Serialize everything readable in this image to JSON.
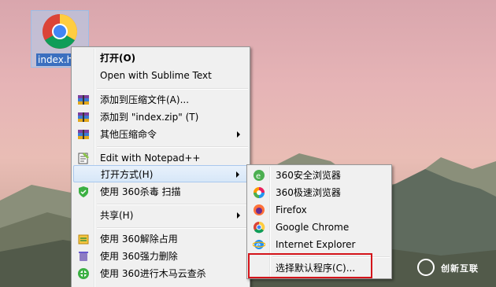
{
  "desktop": {
    "icon_label": "index.h"
  },
  "context_menu": {
    "items": [
      {
        "label": "打开(O)",
        "icon": "none"
      },
      {
        "label": "Open with Sublime Text",
        "icon": "none"
      },
      {
        "label": "添加到压缩文件(A)...",
        "icon": "archive-icon"
      },
      {
        "label": "添加到 \"index.zip\" (T)",
        "icon": "archive-icon"
      },
      {
        "label": "其他压缩命令",
        "icon": "archive-icon"
      },
      {
        "label": "Edit with Notepad++",
        "icon": "notepad-icon"
      },
      {
        "label": "打开方式(H)",
        "icon": "none"
      },
      {
        "label": "使用 360杀毒 扫描",
        "icon": "shield-icon"
      },
      {
        "label": "共享(H)",
        "icon": "none"
      },
      {
        "label": "使用 360解除占用",
        "icon": "unlock-icon"
      },
      {
        "label": "使用 360强力删除",
        "icon": "delete-icon"
      },
      {
        "label": "使用 360进行木马云查杀",
        "icon": "360-scan-icon"
      }
    ]
  },
  "open_with_submenu": {
    "items": [
      {
        "label": "360安全浏览器",
        "icon": "360-safe-browser-icon"
      },
      {
        "label": "360极速浏览器",
        "icon": "360-speed-browser-icon"
      },
      {
        "label": "Firefox",
        "icon": "firefox-icon"
      },
      {
        "label": "Google Chrome",
        "icon": "chrome-icon"
      },
      {
        "label": "Internet Explorer",
        "icon": "ie-icon"
      },
      {
        "label": "选择默认程序(C)...",
        "icon": "none"
      }
    ]
  },
  "watermark": {
    "text": "创新互联"
  },
  "colors": {
    "highlight_box": "#d4141a",
    "menu_bg": "#f0f0f0",
    "hover_bg": "#d7e7f8"
  }
}
